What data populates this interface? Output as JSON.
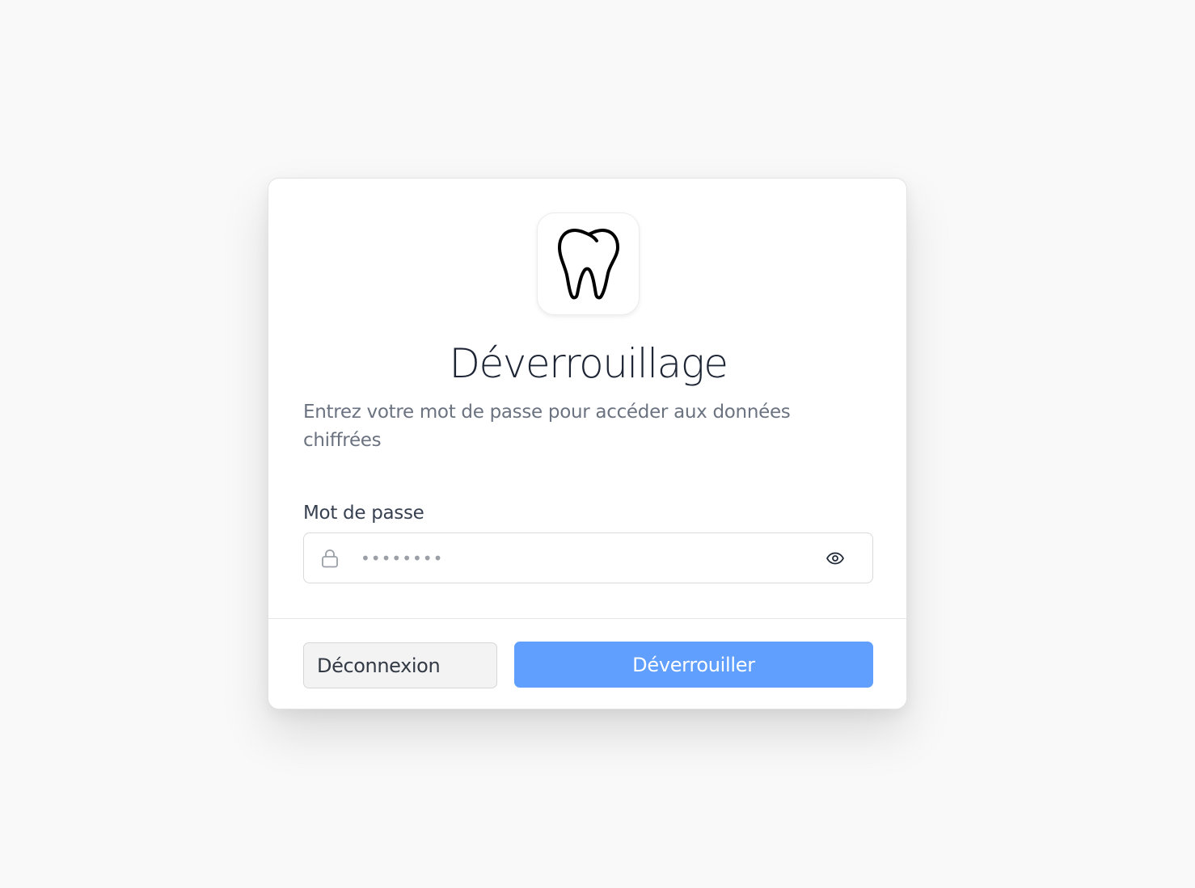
{
  "app": {
    "logo_icon": "tooth-icon"
  },
  "dialog": {
    "title": "Déverrouillage",
    "subtitle": "Entrez votre mot de passe pour accéder aux données chiffrées"
  },
  "password_field": {
    "label": "Mot de passe",
    "value": "",
    "placeholder": "••••••••",
    "leading_icon": "lock-icon",
    "toggle_icon": "eye-icon"
  },
  "actions": {
    "logout_label": "Déconnexion",
    "unlock_label": "Déverrouiller"
  },
  "colors": {
    "primary": "#609ffe",
    "title": "#1e2535",
    "muted": "#6b7280",
    "background": "#f9f9f9"
  }
}
